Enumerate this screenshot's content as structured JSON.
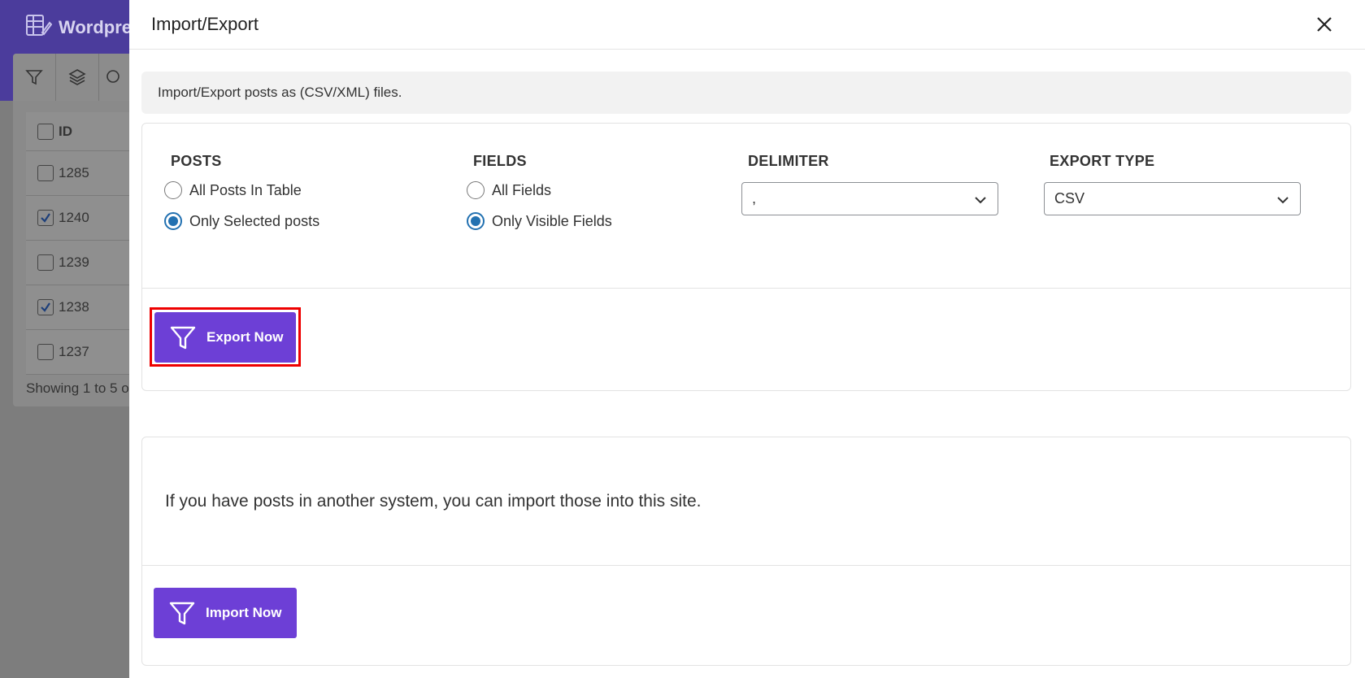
{
  "background": {
    "app_title": "Wordpre",
    "table_header": "ID",
    "rows": [
      {
        "id": "1285",
        "checked": false
      },
      {
        "id": "1240",
        "checked": true
      },
      {
        "id": "1239",
        "checked": false
      },
      {
        "id": "1238",
        "checked": true
      },
      {
        "id": "1237",
        "checked": false
      }
    ],
    "footer": "Showing 1 to 5 o"
  },
  "modal": {
    "title": "Import/Export",
    "info": "Import/Export posts as (CSV/XML) files.",
    "posts": {
      "label": "POSTS",
      "options": [
        "All Posts In Table",
        "Only Selected posts"
      ],
      "selected": "Only Selected posts"
    },
    "fields": {
      "label": "FIELDS",
      "options": [
        "All Fields",
        "Only Visible Fields"
      ],
      "selected": "Only Visible Fields"
    },
    "delimiter": {
      "label": "DELIMITER",
      "value": ","
    },
    "export_type": {
      "label": "EXPORT TYPE",
      "value": "CSV"
    },
    "export_button": "Export Now",
    "import_text": "If you have posts in another system, you can import those into this site.",
    "import_button": "Import Now"
  },
  "colors": {
    "primary": "#6d3fd6",
    "highlight": "#ee0000",
    "radio": "#2271b1"
  }
}
